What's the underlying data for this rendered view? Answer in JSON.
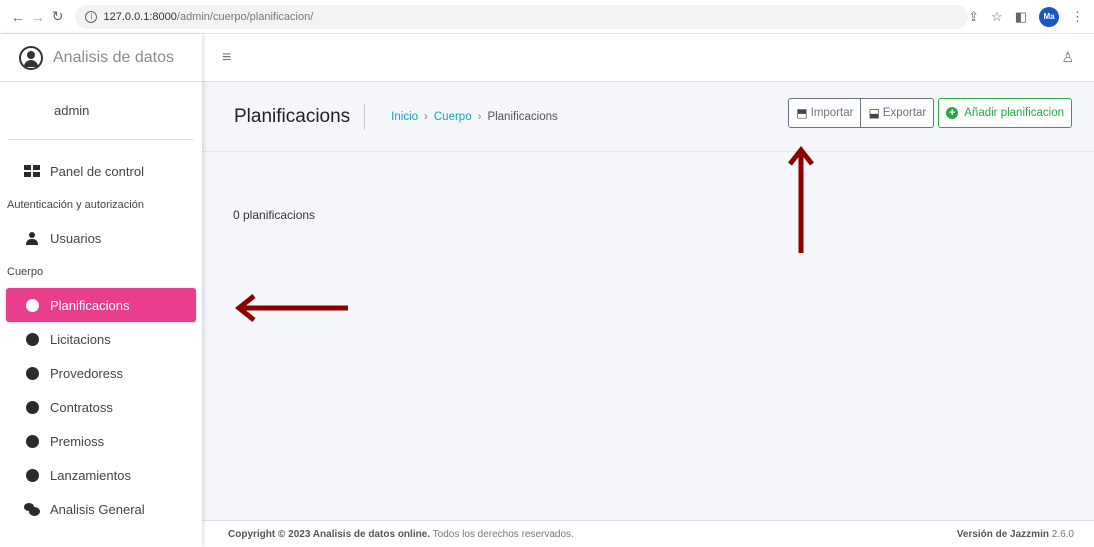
{
  "browser": {
    "url_host": "127.0.0.1:8000",
    "url_path": "/admin/cuerpo/planificacion/",
    "profile_initials": "Ma"
  },
  "sidebar": {
    "brand": "Analisis de datos",
    "user": "admin",
    "items": [
      {
        "type": "item",
        "label": "Panel de control",
        "icon": "dashboard-icon"
      },
      {
        "type": "header",
        "label": "Autenticación y autorización"
      },
      {
        "type": "item",
        "label": "Usuarios",
        "icon": "user-icon"
      },
      {
        "type": "header",
        "label": "Cuerpo"
      },
      {
        "type": "item",
        "label": "Planificacions",
        "icon": "circle-icon",
        "active": true
      },
      {
        "type": "item",
        "label": "Licitacions",
        "icon": "circle-icon"
      },
      {
        "type": "item",
        "label": "Provedoress",
        "icon": "circle-icon"
      },
      {
        "type": "item",
        "label": "Contratoss",
        "icon": "circle-icon"
      },
      {
        "type": "item",
        "label": "Premioss",
        "icon": "circle-icon"
      },
      {
        "type": "item",
        "label": "Lanzamientos",
        "icon": "circle-icon"
      },
      {
        "type": "item",
        "label": "Analisis General",
        "icon": "comments-icon"
      }
    ]
  },
  "header": {
    "title": "Planificacions",
    "breadcrumb": [
      "Inicio",
      "Cuerpo",
      "Planificacions"
    ],
    "buttons": {
      "import": "Importar",
      "export": "Exportar",
      "add": "Añadir planificacion"
    }
  },
  "content": {
    "count_text": "0 planificacions"
  },
  "footer": {
    "copyright_prefix": "Copyright © 2023 ",
    "site": "Analisis de datos online.",
    "rights": " Todos los derechos reservados.",
    "version_label": "Versión de Jazzmin",
    "version": " 2.6.0"
  },
  "colors": {
    "active_item": "#e83e8c",
    "success": "#28a745",
    "link": "#17a2b8",
    "annotation_arrow": "#8b0000"
  }
}
